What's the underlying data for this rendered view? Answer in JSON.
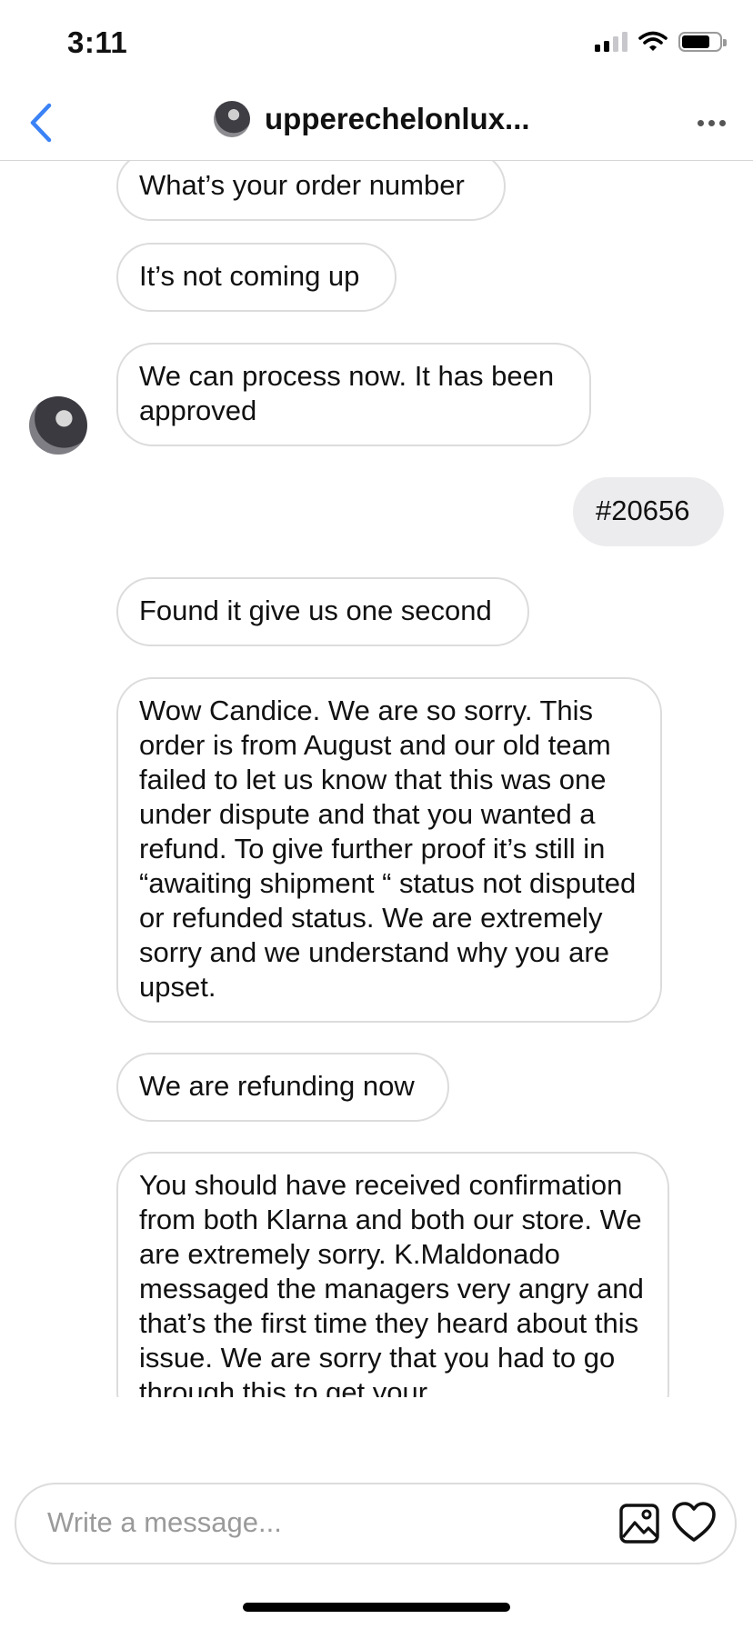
{
  "status_bar": {
    "time": "3:11"
  },
  "header": {
    "title": "upperechelonlux...",
    "back_icon": "chevron-left-icon",
    "more_icon": "ellipsis-icon",
    "accent": "#3b82f6"
  },
  "messages": [
    {
      "sender": "them",
      "text": "What’s your order number"
    },
    {
      "sender": "them",
      "text": "It’s not coming up"
    },
    {
      "sender": "them",
      "text": "We can process now. It has been approved"
    },
    {
      "sender": "me",
      "text": "#20656"
    },
    {
      "sender": "them",
      "text": "Found it give us one second"
    },
    {
      "sender": "them",
      "text": "Wow Candice. We are so sorry. This order is from August and our old team failed to let us know that this was one under dispute and that you wanted a refund. To give further proof it’s still in “awaiting shipment “ status not disputed or refunded status. We are extremely sorry and we understand why you are upset."
    },
    {
      "sender": "them",
      "text": "We are refunding now"
    },
    {
      "sender": "them",
      "text": "You should have received confirmation from both Klarna and both our store. We are extremely sorry. K.Maldonado messaged the managers very angry and that’s the first time they heard about this issue. We are sorry that you had to go through this to get your"
    }
  ],
  "composer": {
    "placeholder": "Write a message...",
    "photo_icon": "image-icon",
    "heart_icon": "heart-icon"
  },
  "colors": {
    "my_bubble": "#ececee",
    "their_bubble_border": "#dcdcdc"
  }
}
